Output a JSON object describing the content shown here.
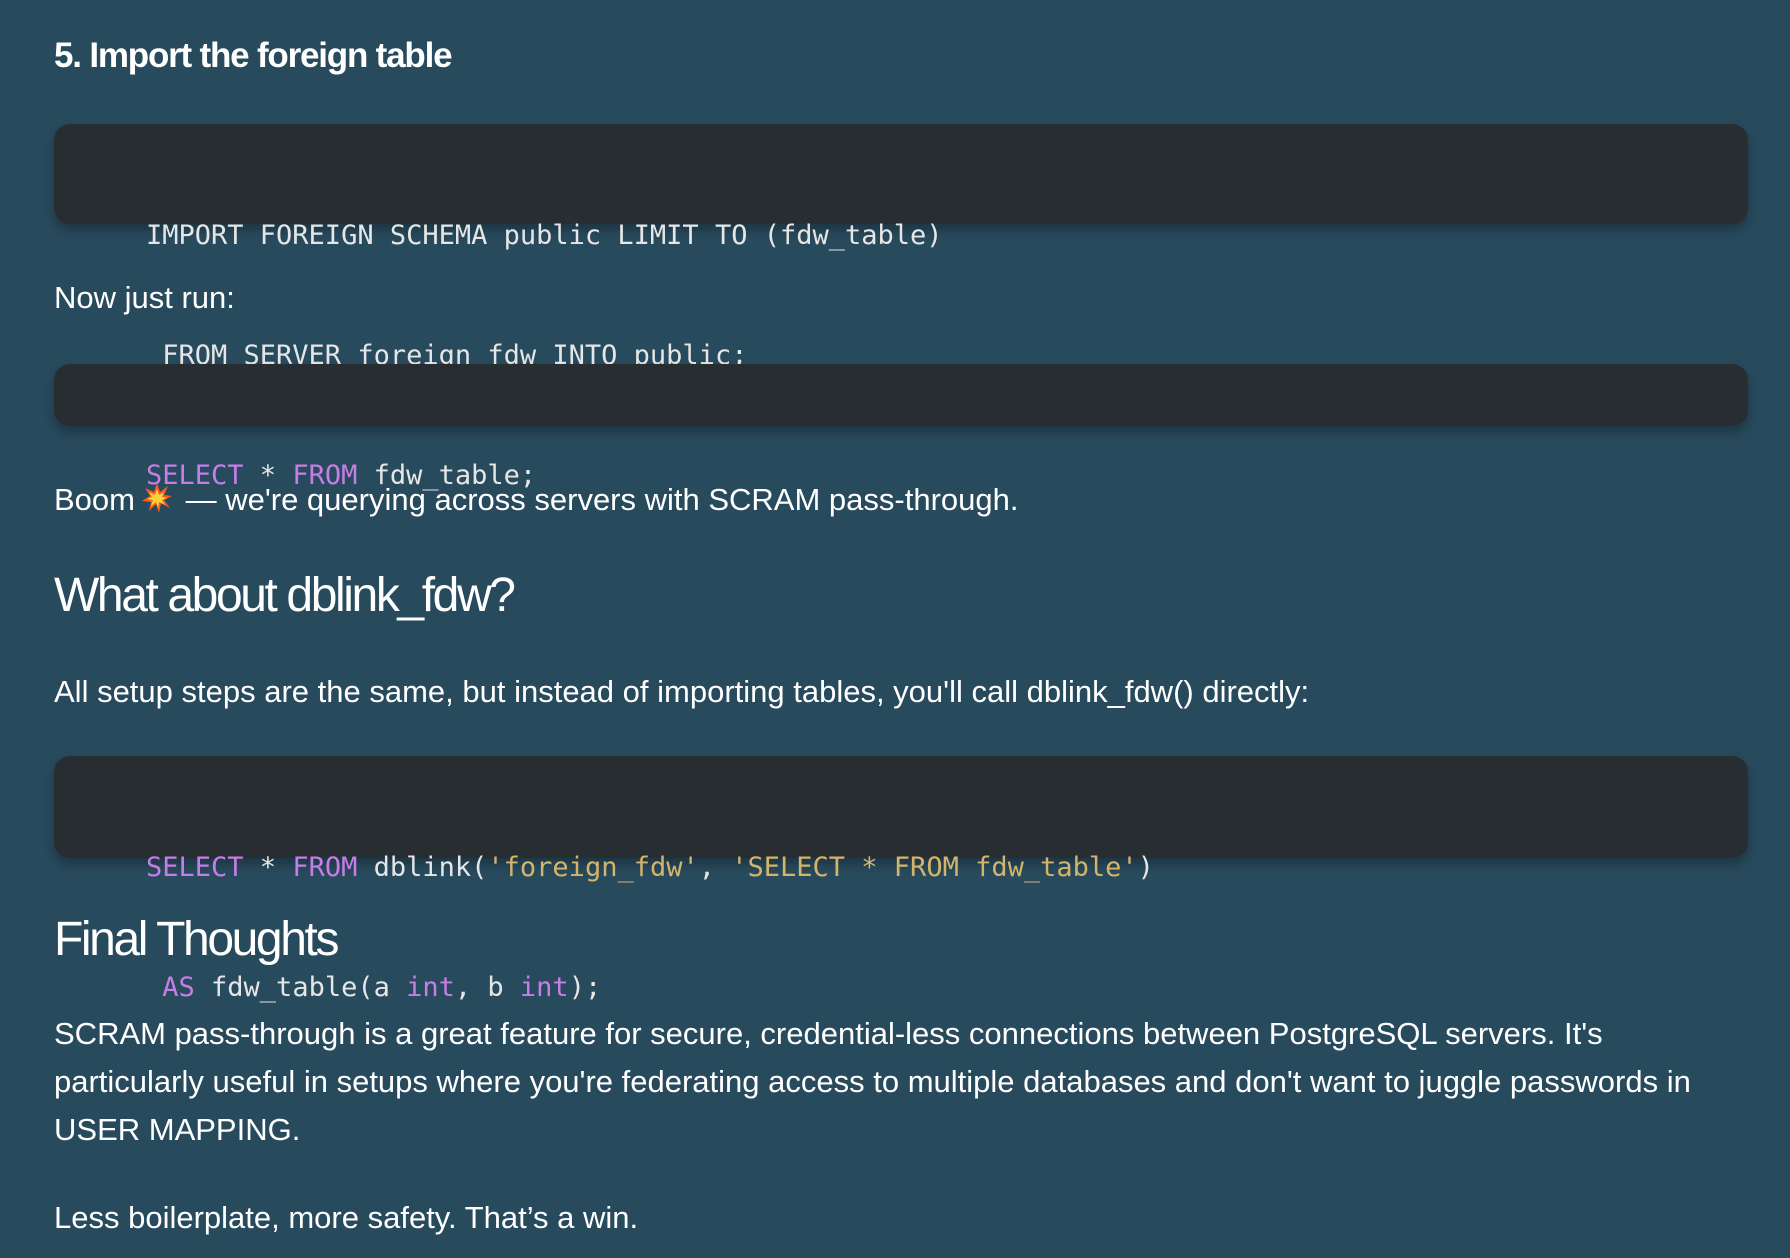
{
  "step_heading": "5. Import the foreign table",
  "code1": {
    "line1": "IMPORT FOREIGN SCHEMA public LIMIT TO (fdw_table)",
    "line2": " FROM SERVER foreign_fdw INTO public;"
  },
  "para_run": "Now just run:",
  "code2": {
    "kw1": "SELECT",
    "t1": " * ",
    "kw2": "FROM",
    "t2": " fdw_table;"
  },
  "para_boom": {
    "before": "Boom",
    "icon": "collision-icon",
    "after": " — we're querying across servers with SCRAM pass-through."
  },
  "h_dblink": "What about dblink_fdw?",
  "para_dblink": "All setup steps are the same, but instead of importing tables, you'll call dblink_fdw() directly:",
  "code3": {
    "l1_kw1": "SELECT",
    "l1_t1": " * ",
    "l1_kw2": "FROM",
    "l1_t2": " dblink(",
    "l1_s1": "'foreign_fdw'",
    "l1_t3": ", ",
    "l1_s2": "'SELECT * FROM fdw_table'",
    "l1_t4": ")",
    "l2_sp": " ",
    "l2_kw1": "AS",
    "l2_t1": " fdw_table(a ",
    "l2_kw2": "int",
    "l2_t2": ", b ",
    "l2_kw3": "int",
    "l2_t3": ");"
  },
  "h_final": "Final Thoughts",
  "para_final": "SCRAM pass-through is a great feature for secure, credential-less connections between PostgreSQL servers. It's particularly useful in setups where you're federating access to multiple databases and don't want to juggle passwords in USER MAPPING.",
  "para_win": "Less boilerplate, more safety. That’s a win.",
  "colors": {
    "background": "#284a5d",
    "code_bg": "#282d31",
    "keyword": "#c67ee6",
    "string": "#d4b46a"
  }
}
